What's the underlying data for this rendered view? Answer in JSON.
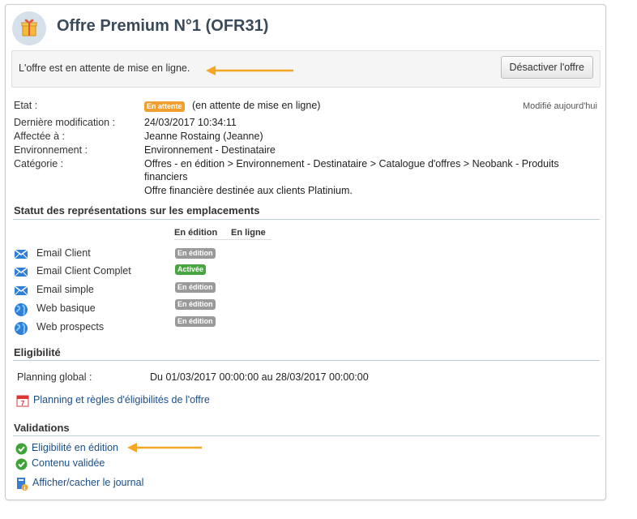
{
  "header": {
    "title": "Offre Premium N°1 (OFR31)"
  },
  "status_bar": {
    "message": "L'offre est en attente de mise en ligne.",
    "button_label": "Désactiver l'offre"
  },
  "info": {
    "modified_note": "Modifié aujourd'hui",
    "state_label": "Etat :",
    "state_badge": "En attente",
    "state_text": "(en attente de mise en ligne)",
    "last_modified_label": "Dernière modification :",
    "last_modified_value": "24/03/2017 10:34:11",
    "assigned_label": "Affectée à :",
    "assigned_value": "Jeanne Rostaing (Jeanne)",
    "environment_label": "Environnement :",
    "environment_value": "Environnement - Destinataire",
    "category_label": "Catégorie :",
    "category_value_line1": "Offres - en édition > Environnement - Destinataire > Catalogue d'offres > Neobank - Produits",
    "category_value_line2": "financiers",
    "category_value_line3": "Offre financière destinée aux clients Platinium."
  },
  "locations": {
    "title": "Statut des représentations sur les emplacements",
    "col_edition": "En édition",
    "col_online": "En ligne",
    "rows": [
      {
        "label": "Email Client",
        "icon": "email-icon",
        "status": "En édition"
      },
      {
        "label": "Email Client Complet",
        "icon": "email-icon",
        "status": "Activée"
      },
      {
        "label": "Email simple",
        "icon": "email-icon",
        "status": "En édition"
      },
      {
        "label": "Web basique",
        "icon": "globe-icon",
        "status": "En édition"
      },
      {
        "label": "Web prospects",
        "icon": "globe-icon",
        "status": "En édition"
      }
    ]
  },
  "eligibility": {
    "title": "Eligibilité",
    "planning_label": "Planning global :",
    "planning_value": "Du 01/03/2017 00:00:00 au 28/03/2017 00:00:00",
    "planning_link": "Planning et règles d'éligibilités de l'offre"
  },
  "validations": {
    "title": "Validations",
    "item1": "Eligibilité en édition",
    "item2": "Contenu validée",
    "journal_link": "Afficher/cacher le journal"
  },
  "colors": {
    "accent_arrow": "#f5a623",
    "badge_pending": "#f0a030",
    "badge_edition": "#9a9a9a",
    "badge_active": "#49a542",
    "link": "#1a4e8a"
  }
}
